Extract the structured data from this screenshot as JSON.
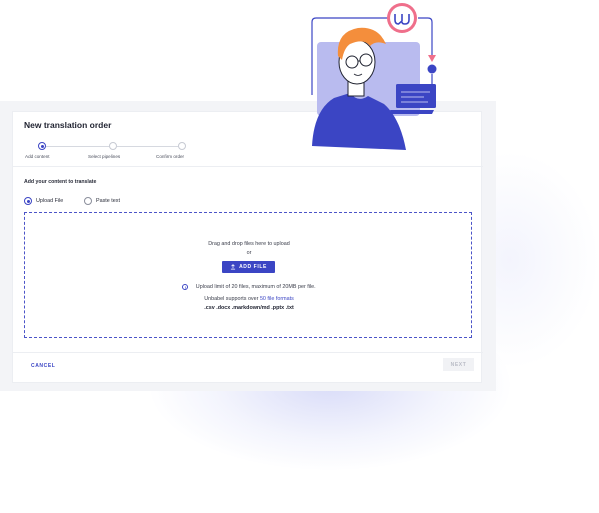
{
  "dialog": {
    "title": "New translation order"
  },
  "stepper": {
    "steps": [
      {
        "label": "Add content",
        "state": "active"
      },
      {
        "label": "Select pipelines",
        "state": "pending"
      },
      {
        "label": "Confirm order",
        "state": "pending"
      }
    ]
  },
  "content": {
    "section_label": "Add your content to translate",
    "options": [
      {
        "label": "Upload File",
        "selected": true
      },
      {
        "label": "Paste text",
        "selected": false
      }
    ]
  },
  "dropzone": {
    "drag_text": "Drag and drop files here to upload",
    "or_text": "or",
    "add_file_label": "ADD FILE",
    "upload_icon": "upload-icon",
    "info_icon": "info-icon",
    "limit_text": "Upload limit of 20 files, maximum of 20MB per file.",
    "supports_prefix": "Unbabel supports over ",
    "supports_link": "50 file formats",
    "formats_text": ".csv .docx .markdown/md .pptx .txt"
  },
  "footer": {
    "cancel_label": "CANCEL",
    "next_label": "NEXT"
  },
  "colors": {
    "accent": "#3b45c4",
    "illustration_orange": "#f48e3c",
    "illustration_pink": "#ef6f8b",
    "illustration_lavender": "#b9bbef"
  }
}
